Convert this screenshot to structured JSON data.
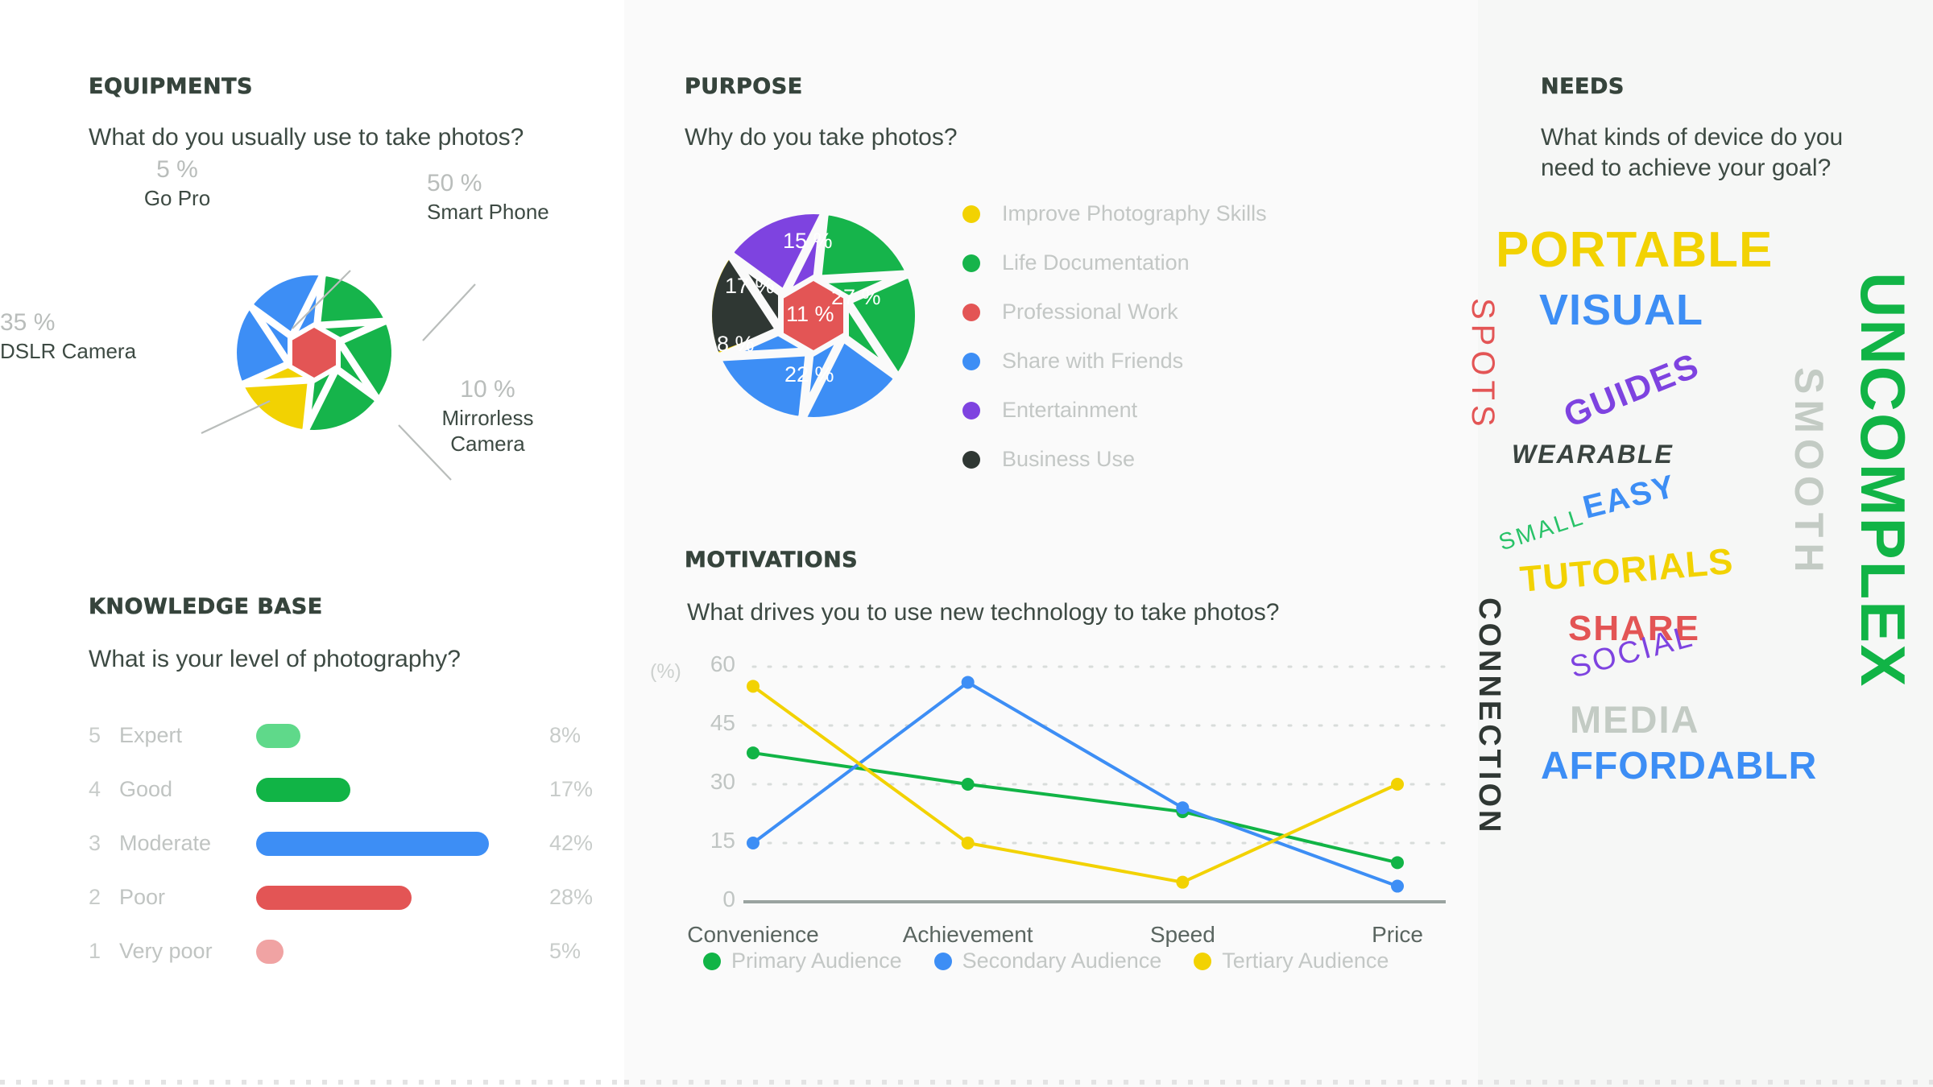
{
  "sections": {
    "equipments": {
      "title": "EQUIPMENTS",
      "question": "What do you usually use to take photos?"
    },
    "knowledge": {
      "title": "KNOWLEDGE BASE",
      "question": "What is your level of photography?"
    },
    "purpose": {
      "title": "PURPOSE",
      "question": "Why do you take photos?"
    },
    "motivations": {
      "title": "MOTIVATIONS",
      "question": "What drives you to use new technology to take photos?"
    },
    "needs": {
      "title": "NEEDS",
      "question": "What kinds of device do you need to achieve your goal?"
    }
  },
  "chart_data": [
    {
      "type": "pie",
      "name": "equipments-aperture-chart",
      "title": "What do you usually use to take photos?",
      "labels": [
        "Smart Phone",
        "Mirrorless Camera",
        "DSLR Camera",
        "Go Pro"
      ],
      "values": [
        50,
        10,
        35,
        5
      ],
      "value_labels": [
        "50 %",
        "10 %",
        "35 %",
        "5 %"
      ],
      "colors": [
        "#16b44b",
        "#f2d202",
        "#3d8ef5",
        "#e35555"
      ],
      "legend": "callouts"
    },
    {
      "type": "pie",
      "name": "purpose-aperture-chart",
      "title": "Why do you take photos?",
      "labels": [
        "Improve Photography Skills",
        "Life Documentation",
        "Professional Work",
        "Share with Friends",
        "Entertainment",
        "Business Use"
      ],
      "values": [
        17,
        27,
        11,
        22,
        15,
        8
      ],
      "value_labels": [
        "17 %",
        "27 %",
        "11 %",
        "22 %",
        "15 %",
        "8 %"
      ],
      "colors": [
        "#f2d202",
        "#16b44b",
        "#e35555",
        "#3d8ef5",
        "#7e43e0",
        "#2f3733"
      ],
      "legend": "right"
    },
    {
      "type": "bar",
      "name": "knowledge-base-bar-chart",
      "title": "What is your level of photography?",
      "orientation": "horizontal",
      "categories": [
        "Expert",
        "Good",
        "Moderate",
        "Poor",
        "Very poor"
      ],
      "ranks": [
        "5",
        "4",
        "3",
        "2",
        "1"
      ],
      "values": [
        8,
        17,
        42,
        28,
        5
      ],
      "value_labels": [
        "8%",
        "17%",
        "42%",
        "28%",
        "5%"
      ],
      "colors": [
        "#5fd98a",
        "#11b446",
        "#3d8ef5",
        "#e35555",
        "#f0a3a3"
      ],
      "xlim": [
        0,
        48
      ]
    },
    {
      "type": "line",
      "name": "motivations-line-chart",
      "title": "What drives you to use new technology to take photos?",
      "xlabel": "",
      "ylabel": "(%)",
      "categories": [
        "Convenience",
        "Achievement",
        "Speed",
        "Price"
      ],
      "yticks": [
        "0",
        "15",
        "30",
        "45",
        "60"
      ],
      "ylim": [
        0,
        60
      ],
      "grid": true,
      "legend_position": "bottom",
      "series": [
        {
          "name": "Primary Audience",
          "color": "#11b446",
          "values": [
            38,
            30,
            23,
            10
          ]
        },
        {
          "name": "Secondary Audience",
          "color": "#3d8ef5",
          "values": [
            15,
            56,
            24,
            4
          ]
        },
        {
          "name": "Tertiary Audience",
          "color": "#f2d202",
          "values": [
            55,
            15,
            5,
            30
          ]
        }
      ]
    }
  ],
  "wordcloud": {
    "name": "needs-word-cloud",
    "words": [
      {
        "text": "PORTABLE",
        "color": "#f2d202"
      },
      {
        "text": "SPOTS",
        "color": "#e35555"
      },
      {
        "text": "VISUAL",
        "color": "#3d8ef5"
      },
      {
        "text": "UNCOMPLEX",
        "color": "#11b446"
      },
      {
        "text": "GUIDES",
        "color": "#7e43e0"
      },
      {
        "text": "SMOOTH",
        "color": "#c3cbc4"
      },
      {
        "text": "WEARABLE",
        "color": "#3a4440"
      },
      {
        "text": "EASY",
        "color": "#3d8ef5"
      },
      {
        "text": "SMALL",
        "color": "#28c268"
      },
      {
        "text": "TUTORIALS",
        "color": "#f2d202"
      },
      {
        "text": "CONNECTION",
        "color": "#2f3733"
      },
      {
        "text": "SHARE",
        "color": "#e35555"
      },
      {
        "text": "SOCIAL",
        "color": "#7e43e0"
      },
      {
        "text": "MEDIA",
        "color": "#c3cbc4"
      },
      {
        "text": "AFFORDABLR",
        "color": "#3d8ef5"
      }
    ]
  }
}
